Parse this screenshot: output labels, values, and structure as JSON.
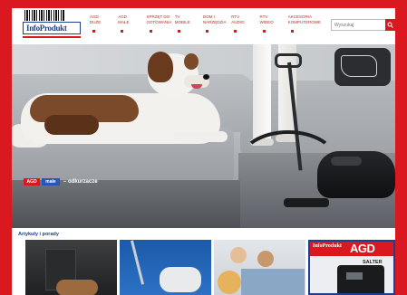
{
  "site": {
    "logo_text": "InfoProdukt",
    "nav": [
      {
        "line1": "AGD",
        "line2": "Duże"
      },
      {
        "line1": "AGD",
        "line2": "Małe"
      },
      {
        "line1": "Sprzęt do",
        "line2": "Gotowania"
      },
      {
        "line1": "TV",
        "line2": "Mobile"
      },
      {
        "line1": "Dom i",
        "line2": "Narzędzia"
      },
      {
        "line1": "RTV",
        "line2": "Audio"
      },
      {
        "line1": "RTV",
        "line2": "Wideo"
      },
      {
        "line1": "Akcesoria",
        "line2": "Komputerowe"
      }
    ],
    "search": {
      "placeholder": "Wyszukaj"
    },
    "colors": {
      "brand_red": "#d9191f",
      "brand_blue": "#1e3f8f"
    }
  },
  "hero": {
    "label_red": "AGD",
    "label_blue": "małe",
    "label_text": "– odkurzacze"
  },
  "articles": {
    "title": "Artykuły i porady",
    "magazine": {
      "small": "InfoProdukt",
      "big": "AGD",
      "brand": "SALTER"
    }
  }
}
